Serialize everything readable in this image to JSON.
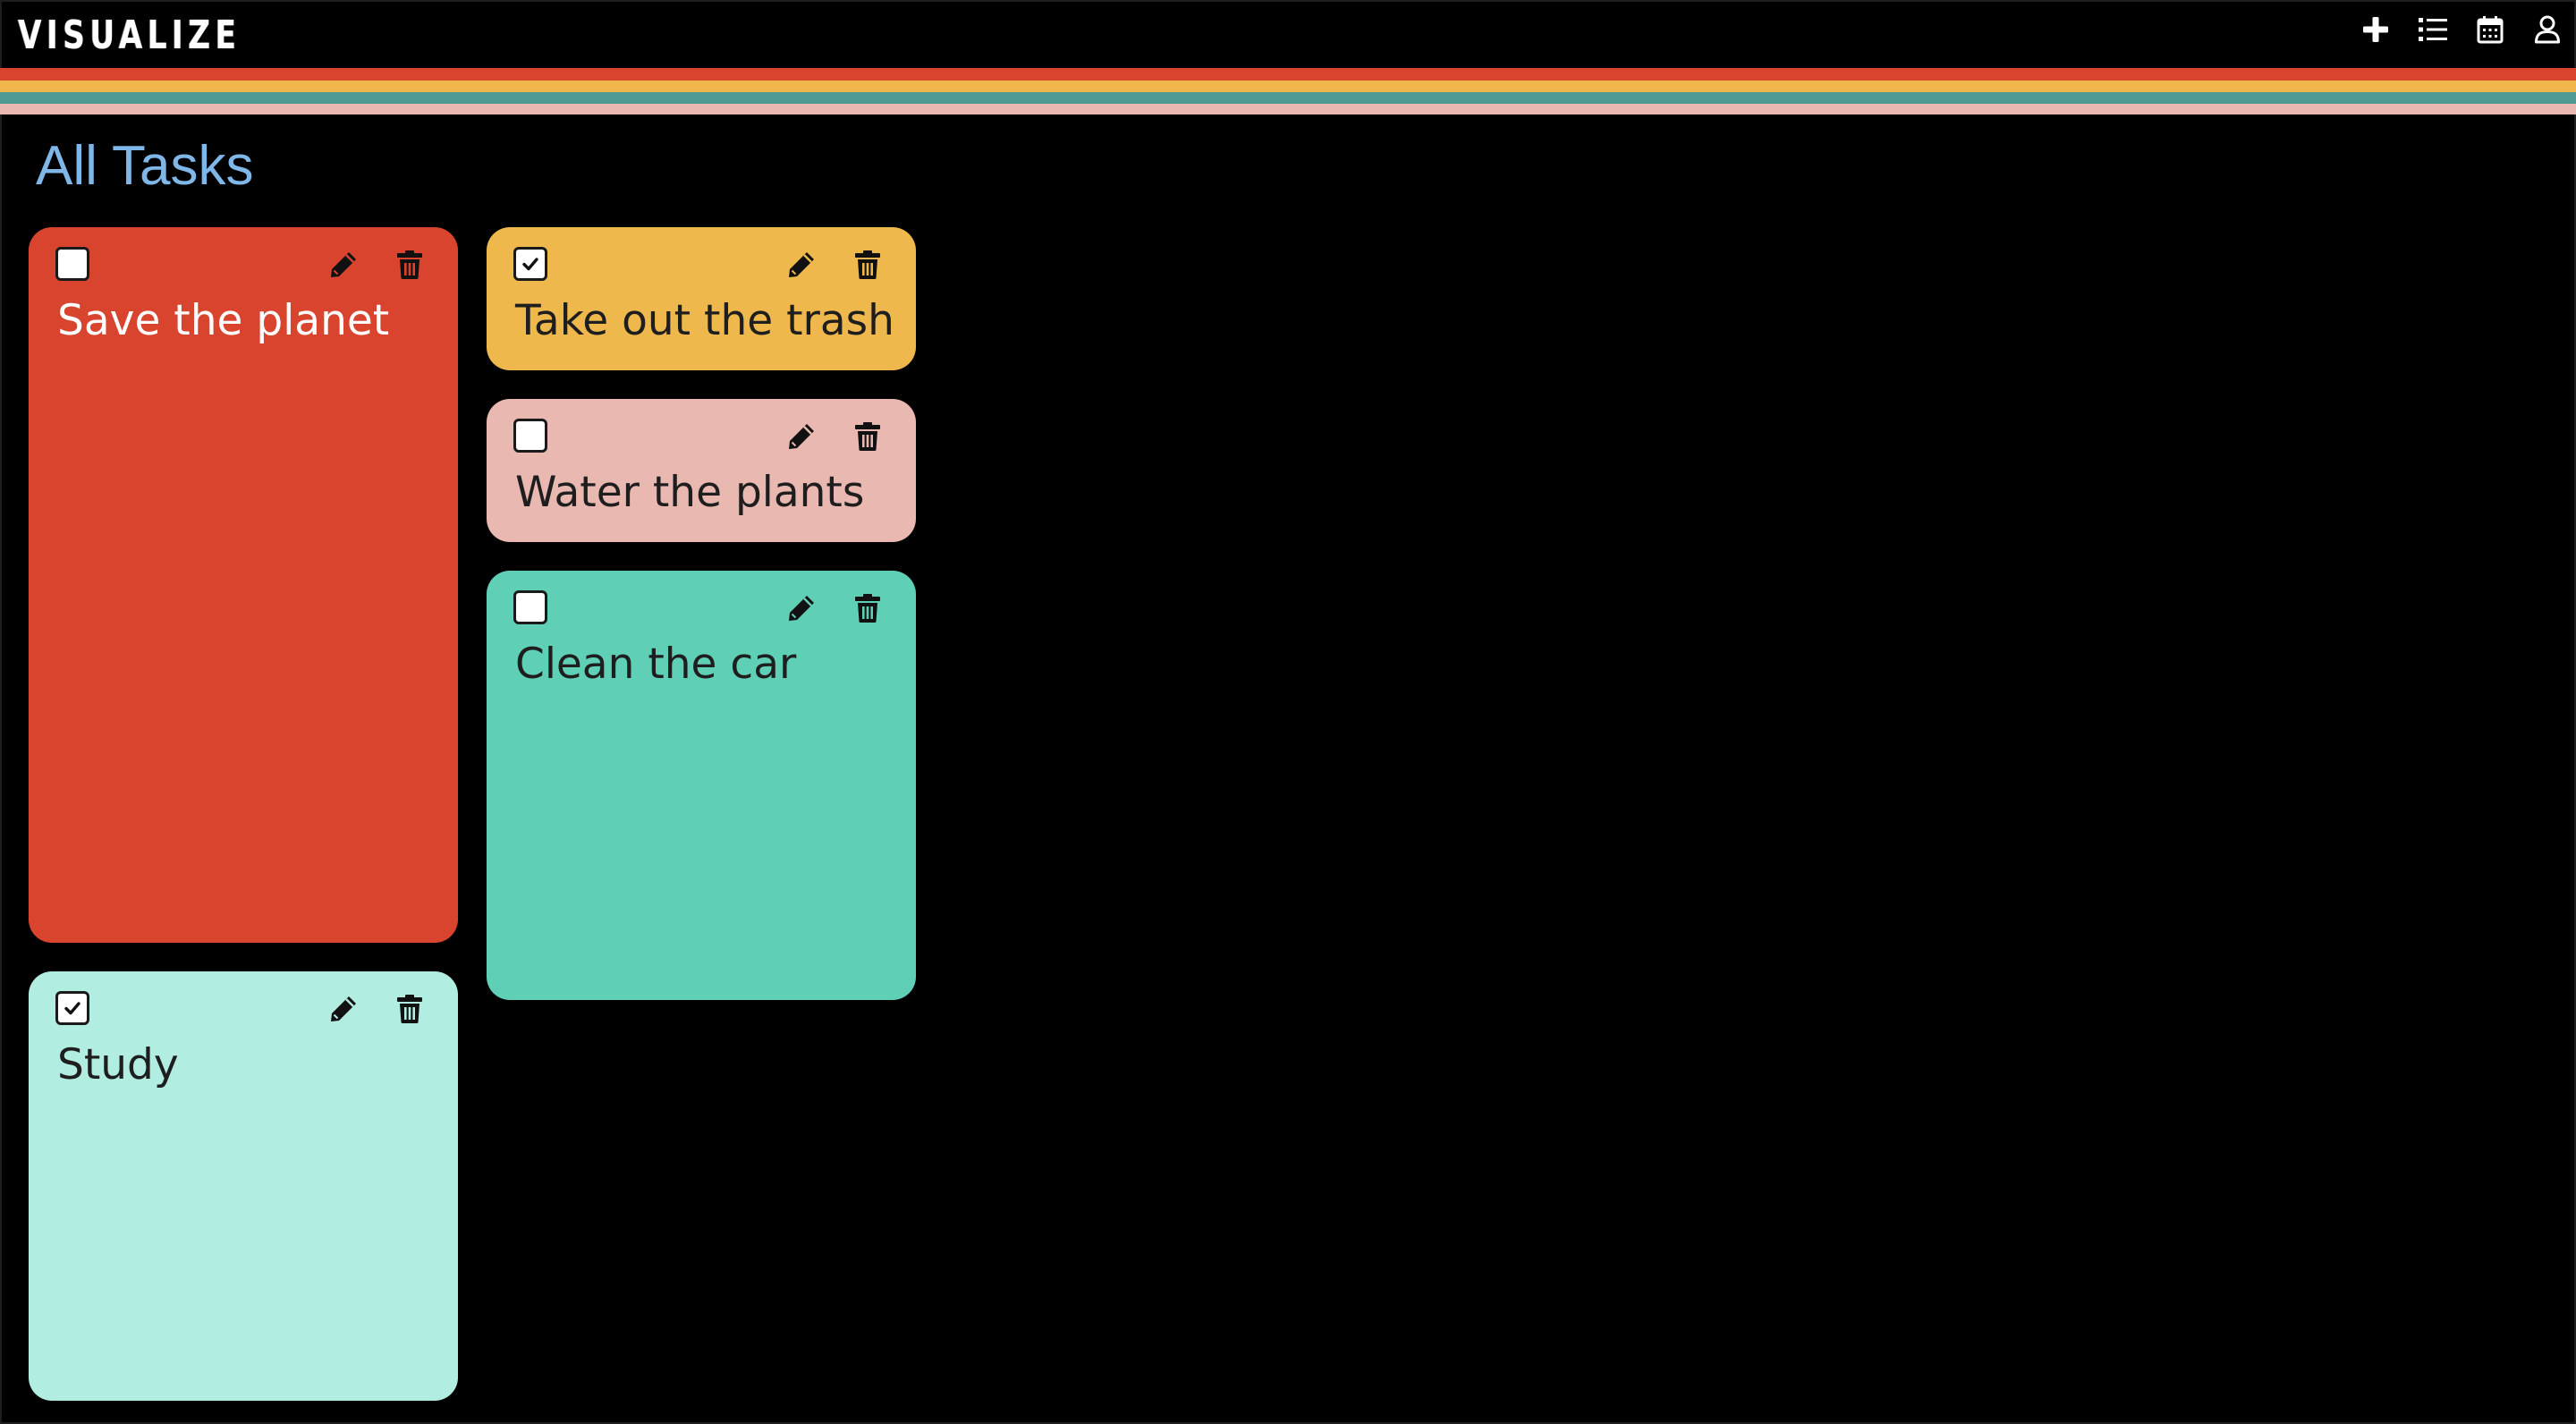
{
  "app": {
    "logo": "VISUALIZE"
  },
  "nav": {
    "items": [
      {
        "name": "add-task-button",
        "icon": "plus-icon"
      },
      {
        "name": "list-view-button",
        "icon": "list-icon"
      },
      {
        "name": "calendar-view-button",
        "icon": "calendar-icon"
      },
      {
        "name": "profile-button",
        "icon": "user-icon"
      }
    ],
    "icon_color": "#ffffff"
  },
  "stripes": [
    "#d9442e",
    "#efb64c",
    "#4e9a93",
    "#eab8b0"
  ],
  "page": {
    "title": "All Tasks",
    "title_color": "#7fb8e8"
  },
  "tasks": [
    {
      "title": "Save the planet",
      "color": "#d9442e",
      "text_color": "#ffffff",
      "checked": false
    },
    {
      "title": "Take out the trash",
      "color": "#efb84c",
      "text_color": "#1e1e1e",
      "checked": true
    },
    {
      "title": "Water the plants",
      "color": "#e9b8b0",
      "text_color": "#1e1e1e",
      "checked": false
    },
    {
      "title": "Clean the car",
      "color": "#5fcfb6",
      "text_color": "#1e1e1e",
      "checked": false
    },
    {
      "title": "Study",
      "color": "#b2ede2",
      "text_color": "#1e1e1e",
      "checked": true
    }
  ]
}
